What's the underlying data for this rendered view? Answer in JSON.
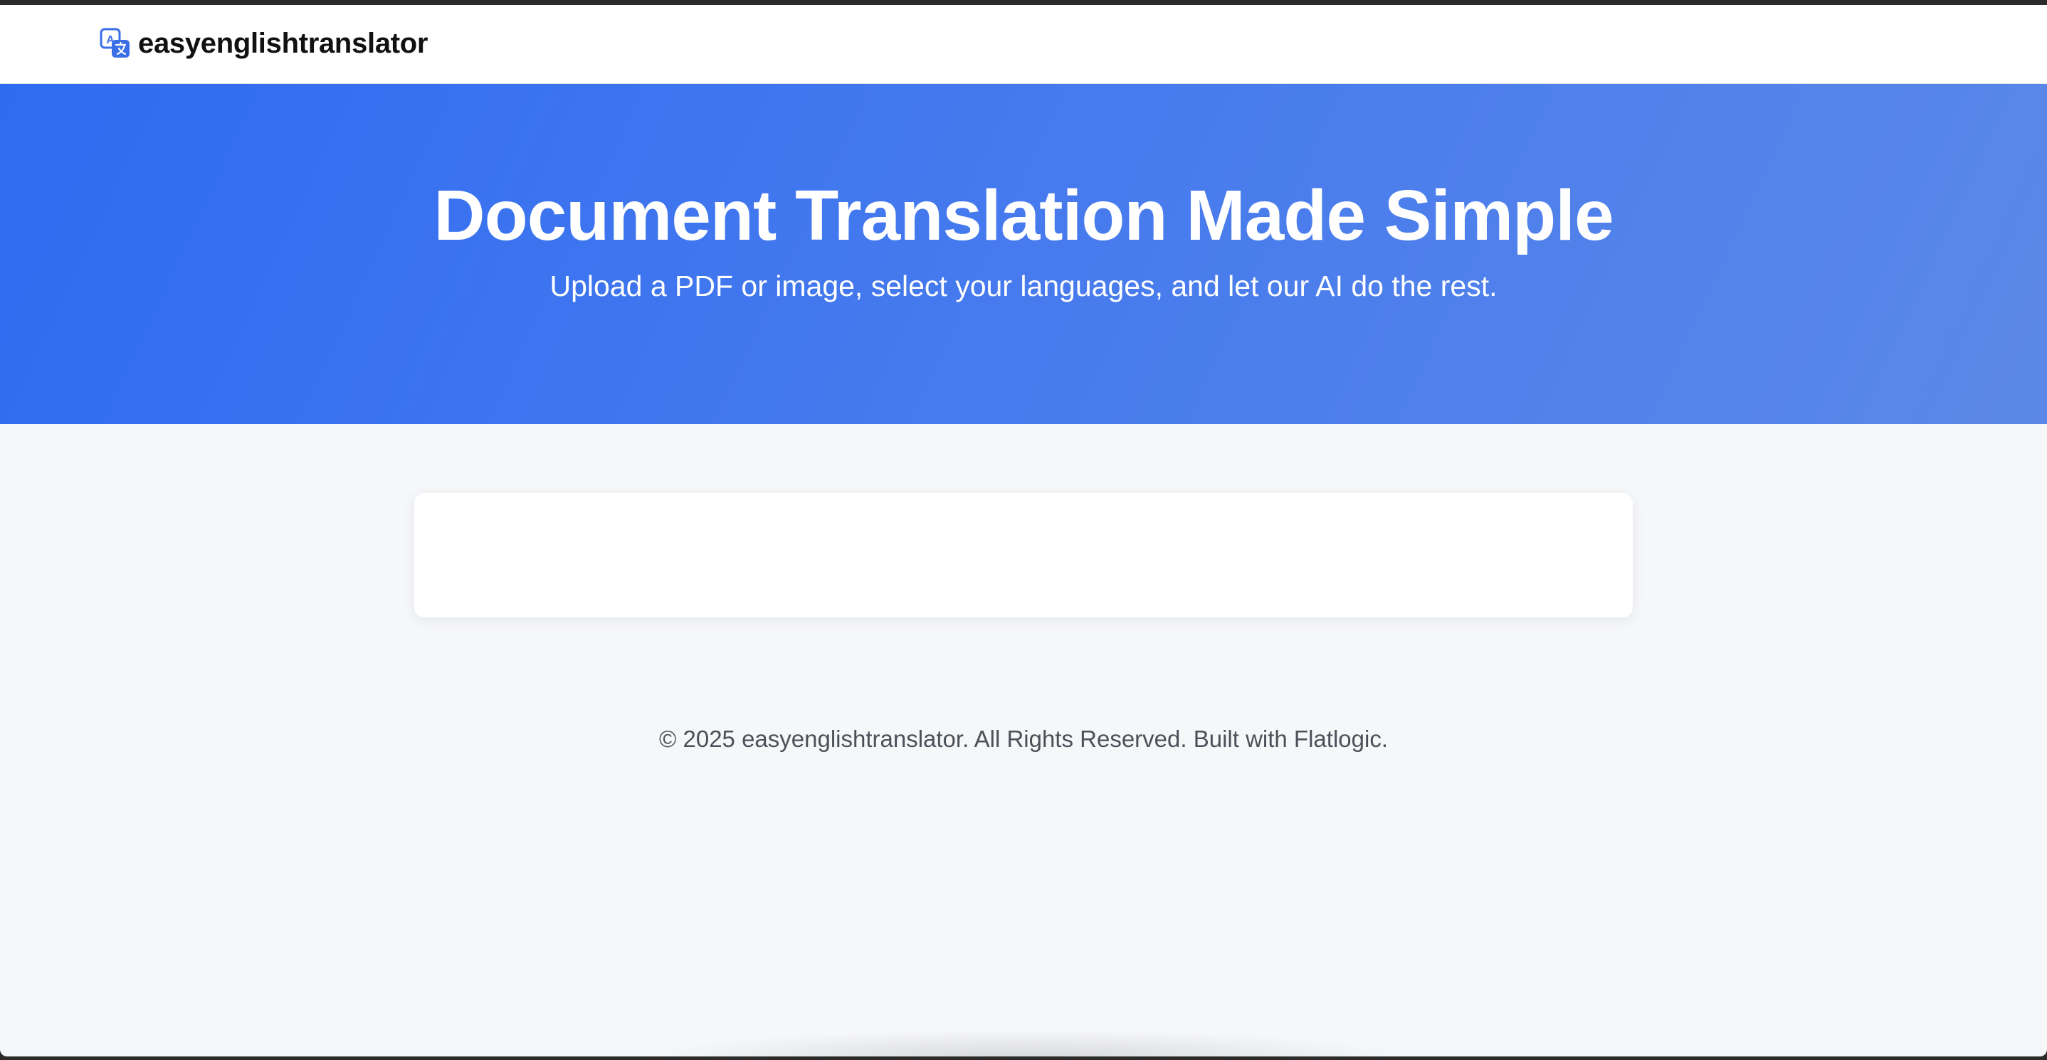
{
  "navbar": {
    "brand_name": "easyenglishtranslator",
    "brand_icon": "translate-icon",
    "brand_icon_glyph": "A",
    "brand_color": "#3b6fe8"
  },
  "hero": {
    "title": "Document Translation Made Simple",
    "subtitle": "Upload a PDF or image, select your languages, and let our AI do the rest.",
    "gradient_start": "#2f6bf1",
    "gradient_end": "#5b88e8"
  },
  "footer": {
    "text": "© 2025 easyenglishtranslator. All Rights Reserved. Built with Flatlogic."
  }
}
